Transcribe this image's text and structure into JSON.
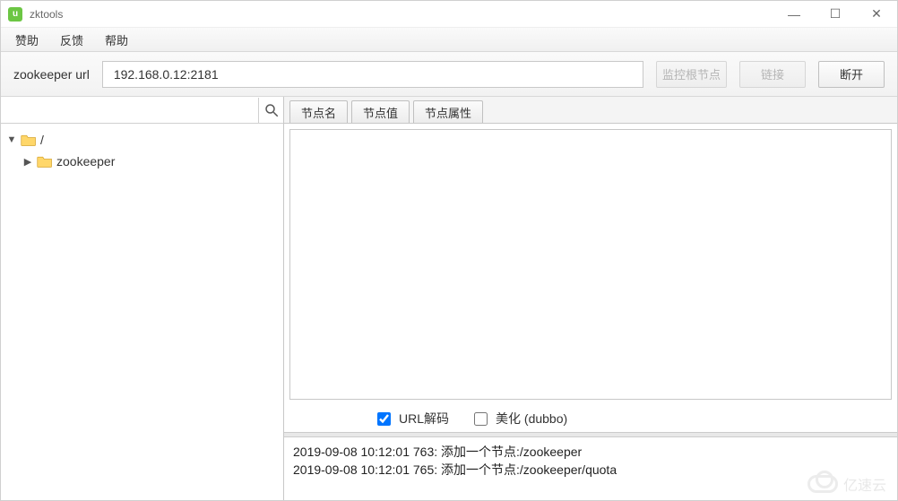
{
  "app": {
    "title": "zktools",
    "icon_letter": "u"
  },
  "window_controls": {
    "min": "—",
    "max": "☐",
    "close": "✕"
  },
  "menubar": {
    "items": [
      "赞助",
      "反馈",
      "帮助"
    ]
  },
  "toolbar": {
    "label": "zookeeper url",
    "url_value": "192.168.0.12:2181",
    "btn_monitor": "监控根节点",
    "btn_connect": "链接",
    "btn_disconnect": "断开"
  },
  "tree": {
    "root": {
      "label": "/"
    },
    "children": [
      {
        "label": "zookeeper"
      }
    ]
  },
  "tabs": {
    "items": [
      "节点名",
      "节点值",
      "节点属性"
    ]
  },
  "options": {
    "url_decode": {
      "label": "URL解码",
      "checked": true
    },
    "beautify": {
      "label": "美化 (dubbo)",
      "checked": false
    }
  },
  "log": {
    "lines": [
      "2019-09-08 10:12:01 763: 添加一个节点:/zookeeper",
      "2019-09-08 10:12:01 765: 添加一个节点:/zookeeper/quota"
    ]
  },
  "watermark": {
    "text": "亿速云"
  }
}
